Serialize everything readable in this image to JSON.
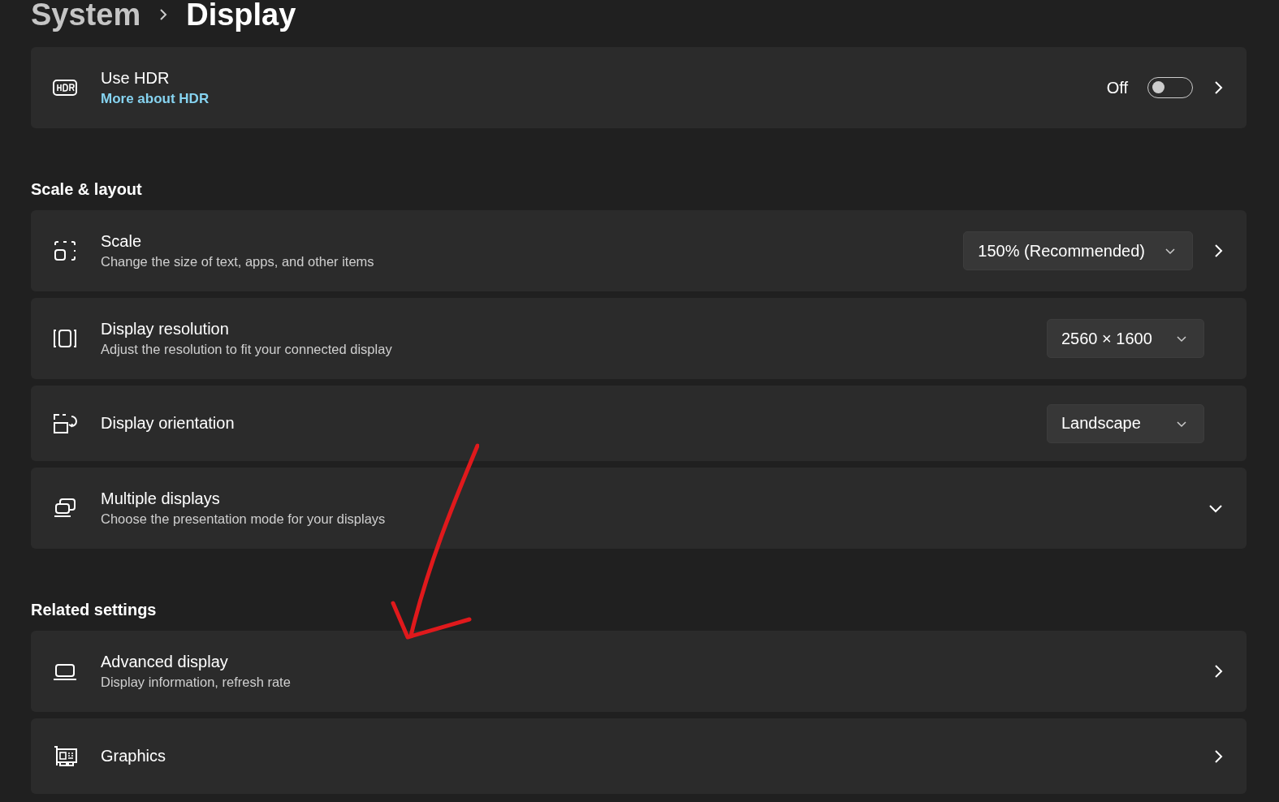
{
  "breadcrumb": {
    "parent": "System",
    "current": "Display"
  },
  "sections": [
    {
      "items": [
        {
          "kind": "toggle",
          "title": "Use HDR",
          "link": "More about HDR",
          "state_label": "Off",
          "on": false,
          "navigable": true
        }
      ]
    },
    {
      "title": "Scale & layout",
      "items": [
        {
          "kind": "dropdown",
          "title": "Scale",
          "subtitle": "Change the size of text, apps, and other items",
          "value": "150% (Recommended)",
          "navigable": true
        },
        {
          "kind": "dropdown",
          "title": "Display resolution",
          "subtitle": "Adjust the resolution to fit your connected display",
          "value": "2560 × 1600",
          "navigable": false
        },
        {
          "kind": "dropdown",
          "title": "Display orientation",
          "value": "Landscape",
          "navigable": false
        },
        {
          "kind": "expander",
          "title": "Multiple displays",
          "subtitle": "Choose the presentation mode for your displays",
          "expanded": false
        }
      ]
    },
    {
      "title": "Related settings",
      "items": [
        {
          "kind": "link",
          "title": "Advanced display",
          "subtitle": "Display information, refresh rate",
          "navigable": true
        },
        {
          "kind": "link",
          "title": "Graphics",
          "navigable": true
        }
      ]
    }
  ]
}
